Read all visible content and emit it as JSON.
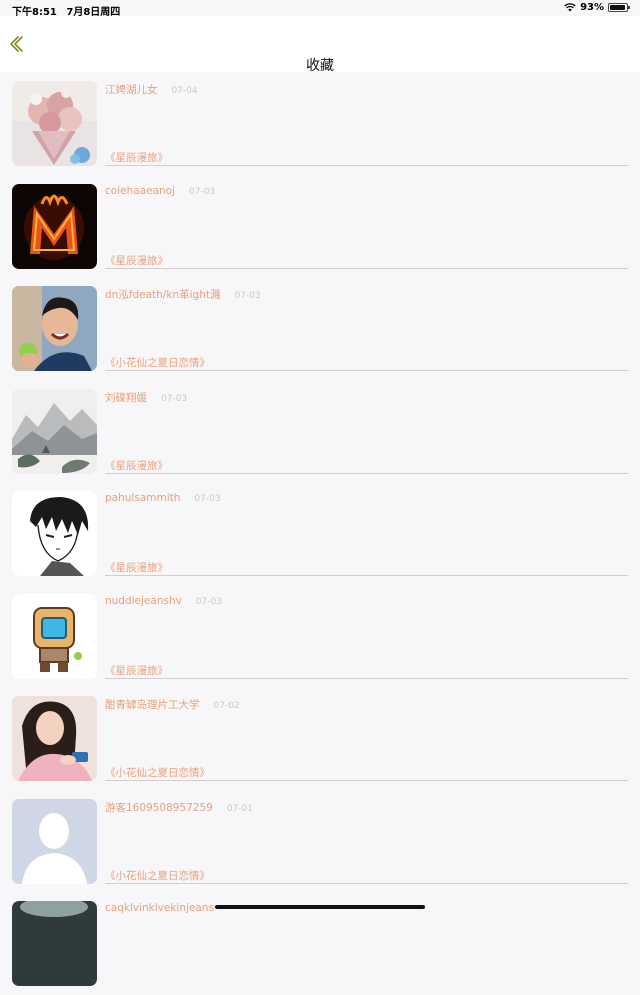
{
  "status_bar": {
    "time": "下午8:51",
    "date": "7月8日周四",
    "battery": "93%"
  },
  "nav": {
    "title": "收藏",
    "back_icon": "chevron-left-icon"
  },
  "colors": {
    "accent": "#e8a17a",
    "back_icon": "#8a8a1a",
    "date": "#c9c9c9"
  },
  "items": [
    {
      "name": "江娉湖儿女",
      "date": "07-04",
      "work": "《星辰漫旅》",
      "avatar": "flower-bouquet"
    },
    {
      "name": "colehaaeanoj",
      "date": "07-03",
      "work": "《星辰漫旅》",
      "avatar": "fire-letter"
    },
    {
      "name": "dn泓fdeath/kn革ight濺",
      "date": "07-03",
      "work": "《小花仙之夏日恋情》",
      "avatar": "man-with-apple"
    },
    {
      "name": "刘碟翔媛",
      "date": "07-03",
      "work": "《星辰漫旅》",
      "avatar": "ink-landscape"
    },
    {
      "name": "pahulsammith",
      "date": "07-03",
      "work": "《星辰漫旅》",
      "avatar": "manga-boy"
    },
    {
      "name": "nuddiejeanshv",
      "date": "07-03",
      "work": "《星辰漫旅》",
      "avatar": "robot-sprite"
    },
    {
      "name": "酣青罅岛理片工大学",
      "date": "07-02",
      "work": "《小花仙之夏日恋情》",
      "avatar": "girl-photo"
    },
    {
      "name": "游客1609508957259",
      "date": "07-01",
      "work": "《小花仙之夏日恋情》",
      "avatar": "default-person"
    },
    {
      "name": "caqklvinklvekinjeans",
      "date": "",
      "work": "",
      "avatar": "dark-landscape"
    }
  ]
}
